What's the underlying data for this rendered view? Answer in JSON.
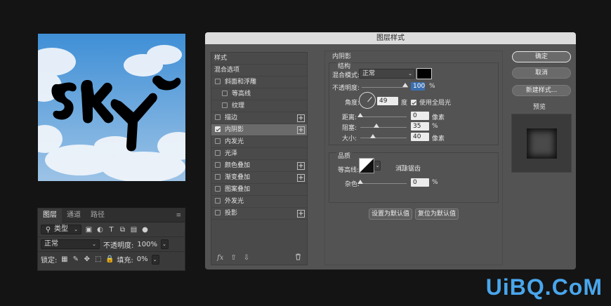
{
  "canvas": {
    "art_text": "SKY"
  },
  "layers_panel": {
    "tabs": [
      "图层",
      "通道",
      "路径"
    ],
    "active_tab": 0,
    "menu_icon": "≡",
    "filter_label": "类型",
    "blend_mode": "正常",
    "opacity_label": "不透明度:",
    "opacity_value": "100%",
    "lock_label": "锁定:",
    "fill_label": "填充:",
    "fill_value": "0%"
  },
  "dialog": {
    "title": "图层样式",
    "styles_list": [
      {
        "label": "样式",
        "type": "head"
      },
      {
        "label": "混合选项",
        "type": "head"
      },
      {
        "label": "斜面和浮雕",
        "checked": false
      },
      {
        "label": "等高线",
        "checked": false,
        "indent": true
      },
      {
        "label": "纹理",
        "checked": false,
        "indent": true
      },
      {
        "label": "描边",
        "checked": false,
        "plus": true
      },
      {
        "label": "内阴影",
        "checked": true,
        "plus": true,
        "selected": true
      },
      {
        "label": "内发光",
        "checked": false
      },
      {
        "label": "光泽",
        "checked": false
      },
      {
        "label": "颜色叠加",
        "checked": false,
        "plus": true
      },
      {
        "label": "渐变叠加",
        "checked": false,
        "plus": true
      },
      {
        "label": "图案叠加",
        "checked": false
      },
      {
        "label": "外发光",
        "checked": false
      },
      {
        "label": "投影",
        "checked": false,
        "plus": true
      }
    ],
    "footer": {
      "fx": "fx",
      "up": "⇧",
      "down": "⇩",
      "trash": "🗑"
    },
    "inner_shadow": {
      "section_title": "内阴影",
      "structure_title": "结构",
      "blend_mode_label": "混合模式:",
      "blend_mode_value": "正常",
      "shadow_color": "#000000",
      "opacity_label": "不透明度:",
      "opacity_value": "100",
      "opacity_unit": "%",
      "angle_label": "角度:",
      "angle_value": "49",
      "angle_unit": "度",
      "global_light_label": "使用全局光",
      "global_light_checked": true,
      "distance_label": "距离:",
      "distance_value": "0",
      "distance_unit": "像素",
      "choke_label": "阻塞:",
      "choke_value": "35",
      "choke_unit": "%",
      "size_label": "大小:",
      "size_value": "40",
      "size_unit": "像素",
      "quality_title": "品质",
      "contour_label": "等高线:",
      "antialias_label": "消除锯齿",
      "antialias_checked": false,
      "noise_label": "杂色:",
      "noise_value": "0",
      "noise_unit": "%",
      "set_default_label": "设置为默认值",
      "reset_default_label": "复位为默认值"
    },
    "buttons": {
      "ok": "确定",
      "cancel": "取消",
      "new_style": "新建样式...",
      "preview_label": "预览",
      "preview_checked": true
    }
  },
  "watermark": "UiBQ.CoM"
}
